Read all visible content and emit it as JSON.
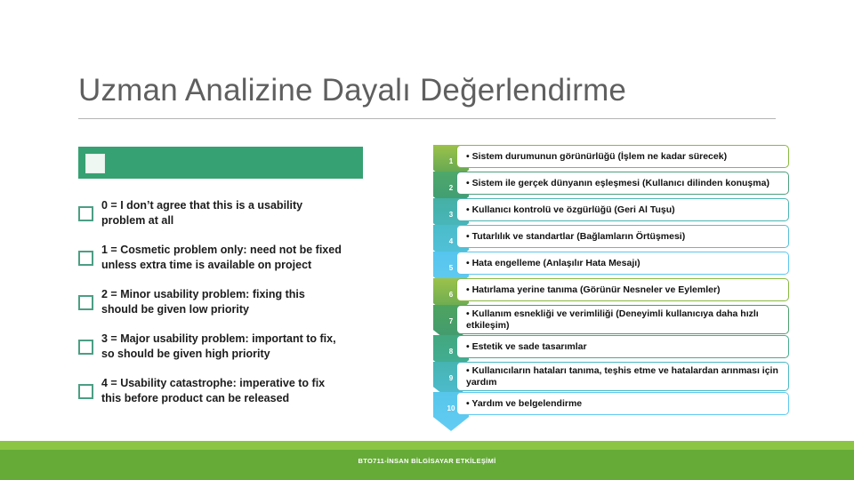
{
  "slide": {
    "title": "Uzman Analizine Dayalı Değerlendirme",
    "footer_text": "BTO711-İNSAN BİLGİSAYAR ETKİLEŞİMİ",
    "colors": {
      "title_gray": "#5f5f5f",
      "rule_gray": "#b4b4b4",
      "highlight_green": "#36a172",
      "checkbox_border": "#4c9e84",
      "footer_light_green": "#8cc544",
      "footer_dark_green": "#66ab38"
    }
  },
  "severity_scale": {
    "highlight_bar": {
      "label": "",
      "color": "#36a172"
    },
    "items": [
      {
        "label": "0 = I don’t agree that this is a usability problem at all"
      },
      {
        "label": "1 = Cosmetic problem only: need not be fixed unless extra time is available on project"
      },
      {
        "label": "2 = Minor usability problem: fixing this should be given low priority"
      },
      {
        "label": "3 = Major usability problem: important to fix, so should be given high priority"
      },
      {
        "label": "4 = Usability catastrophe: imperative to fix this before product can be released"
      }
    ]
  },
  "heuristics": {
    "items": [
      {
        "number": "1",
        "text": "• Sistem durumunun görünürlüğü (İşlem ne kadar sürecek)",
        "color_top": "#9cc24a",
        "color_bottom": "#4f9d57",
        "border": "#8ab840"
      },
      {
        "number": "2",
        "text": "• Sistem ile gerçek dünyanın eşleşmesi (Kullanıcı dilinden konuşma)",
        "color_top": "#4fa86a",
        "color_bottom": "#3b9a76",
        "border": "#4c9e7e"
      },
      {
        "number": "3",
        "text": "• Kullanıcı kontrolü ve özgürlüğü (Geri Al Tuşu)",
        "color_top": "#45b0a4",
        "color_bottom": "#4ab8c4",
        "border": "#4bb3b4"
      },
      {
        "number": "4",
        "text": "• Tutarlılık ve standartlar (Bağlamların Örtüşmesi)",
        "color_top": "#4bbcc8",
        "color_bottom": "#53c2e0",
        "border": "#57bed4"
      },
      {
        "number": "5",
        "text": "• Hata engelleme (Anlaşılır Hata Mesajı)",
        "color_top": "#56c5ee",
        "color_bottom": "#63cbf2",
        "border": "#5cc6ef"
      },
      {
        "number": "6",
        "text": "• Hatırlama yerine tanıma (Görünür Nesneler ve Eylemler)",
        "color_top": "#9cc24a",
        "color_bottom": "#5ba455",
        "border": "#8ab840"
      },
      {
        "number": "7",
        "text": "• Kullanım esnekliği ve verimliliği (Deneyimli kullanıcıya daha hızlı etkileşim)",
        "color_top": "#4fa35f",
        "color_bottom": "#3f9a72",
        "border": "#4c9e6e"
      },
      {
        "number": "8",
        "text": "• Estetik ve sade tasarımlar",
        "color_top": "#43a77e",
        "color_bottom": "#41b09c",
        "border": "#45ab8e"
      },
      {
        "number": "9",
        "text": "• Kullanıcıların hataları tanıma, teşhis etme ve hatalardan arınması için yardım",
        "color_top": "#46b4b0",
        "color_bottom": "#4fbdd4",
        "border": "#4bb8c4"
      },
      {
        "number": "10",
        "text": "• Yardım ve belgelendirme",
        "color_top": "#56c6ea",
        "color_bottom": "#63ccf4",
        "border": "#5cc9f0"
      }
    ]
  }
}
